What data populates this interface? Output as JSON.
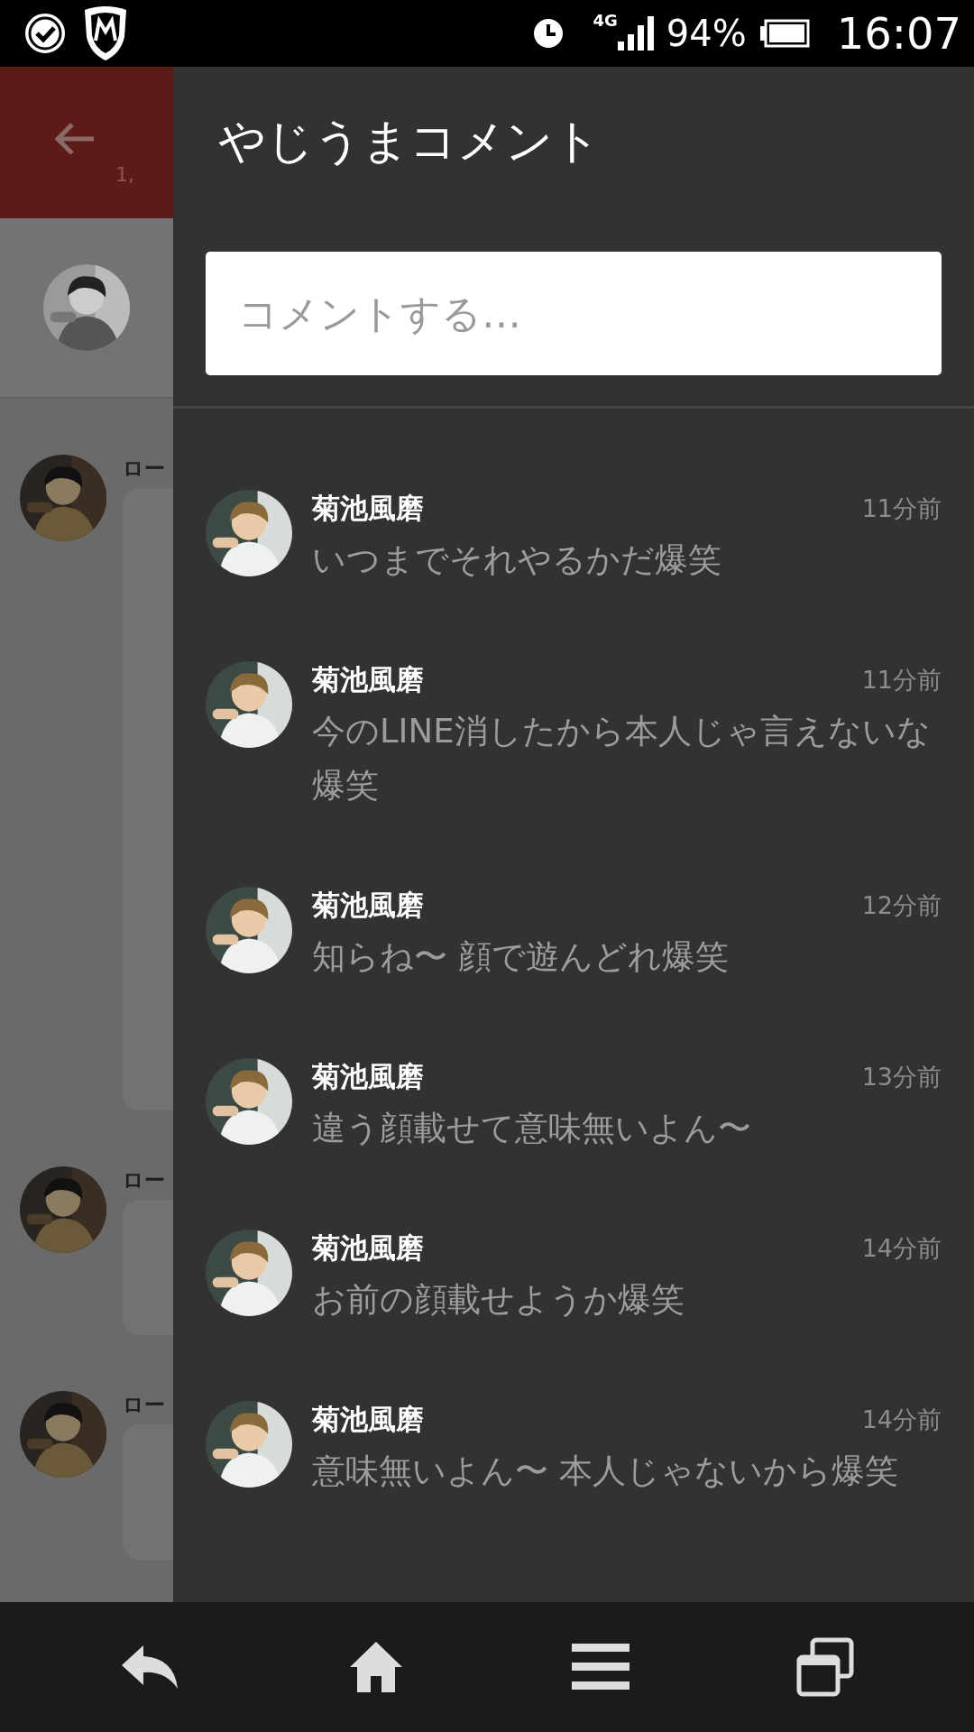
{
  "status_bar": {
    "network": "4G",
    "battery": "94%",
    "time": "16:07"
  },
  "background": {
    "header_subtitle": "1,",
    "posts": [
      {
        "author": "ロー"
      },
      {
        "author": "ロー"
      },
      {
        "author": "ロー"
      }
    ]
  },
  "drawer": {
    "title": "やじうまコメント",
    "comment_field": {
      "placeholder": "コメントする…"
    },
    "comments": [
      {
        "author": "菊池風磨",
        "time": "11分前",
        "text": "いつまでそれやるかだ爆笑"
      },
      {
        "author": "菊池風磨",
        "time": "11分前",
        "text": "今のLINE消したから本人じゃ言えないな爆笑"
      },
      {
        "author": "菊池風磨",
        "time": "12分前",
        "text": "知らね〜  顔で遊んどれ爆笑"
      },
      {
        "author": "菊池風磨",
        "time": "13分前",
        "text": "違う顔載せて意味無いよん〜"
      },
      {
        "author": "菊池風磨",
        "time": "14分前",
        "text": "お前の顔載せようか爆笑"
      },
      {
        "author": "菊池風磨",
        "time": "14分前",
        "text": "意味無いよん〜  本人じゃないから爆笑"
      }
    ]
  }
}
